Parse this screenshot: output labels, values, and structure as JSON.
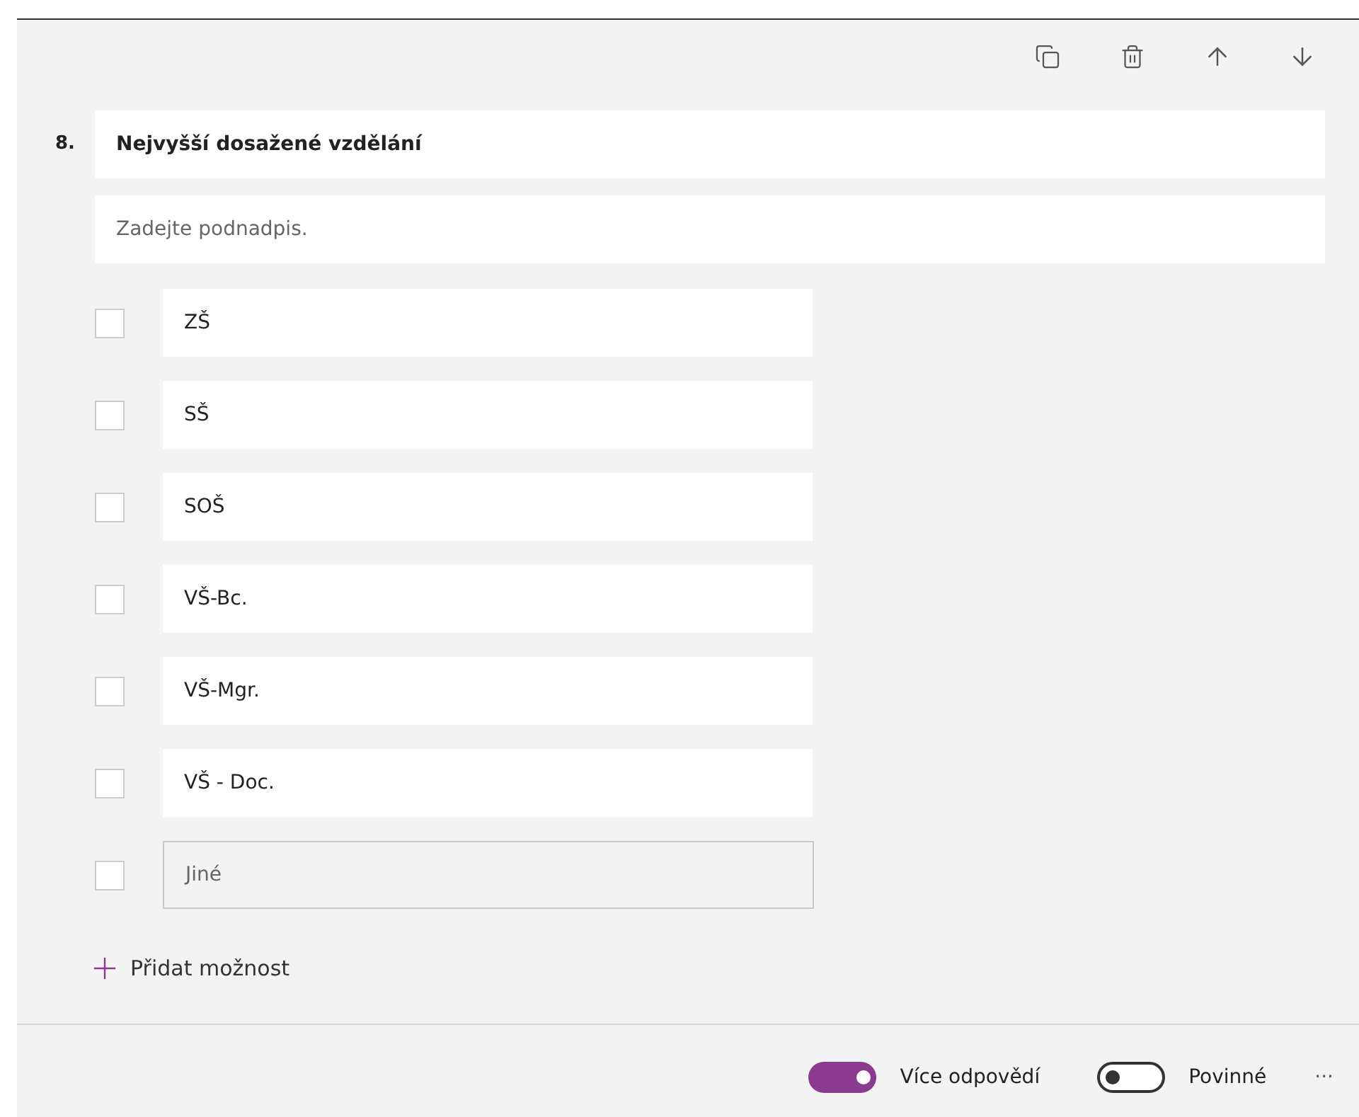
{
  "question": {
    "number": "8.",
    "title": "Nejvyšší dosažené vzdělání",
    "subtitle_placeholder": "Zadejte podnadpis."
  },
  "options": [
    {
      "kind": "text",
      "label": "ZŠ",
      "checked": false
    },
    {
      "kind": "text",
      "label": "SŠ",
      "checked": false
    },
    {
      "kind": "text",
      "label": "SOŠ",
      "checked": false
    },
    {
      "kind": "text",
      "label": "VŠ-Bc.",
      "checked": false
    },
    {
      "kind": "text",
      "label": "VŠ-Mgr.",
      "checked": false
    },
    {
      "kind": "text",
      "label": "VŠ - Doc.",
      "checked": false
    },
    {
      "kind": "other",
      "placeholder": "Jiné",
      "checked": false
    }
  ],
  "add_option": "Přidat možnost",
  "toggles": [
    {
      "label": "Více odpovědí",
      "on": true
    },
    {
      "label": "Povinné",
      "on": false
    }
  ],
  "more": "···"
}
